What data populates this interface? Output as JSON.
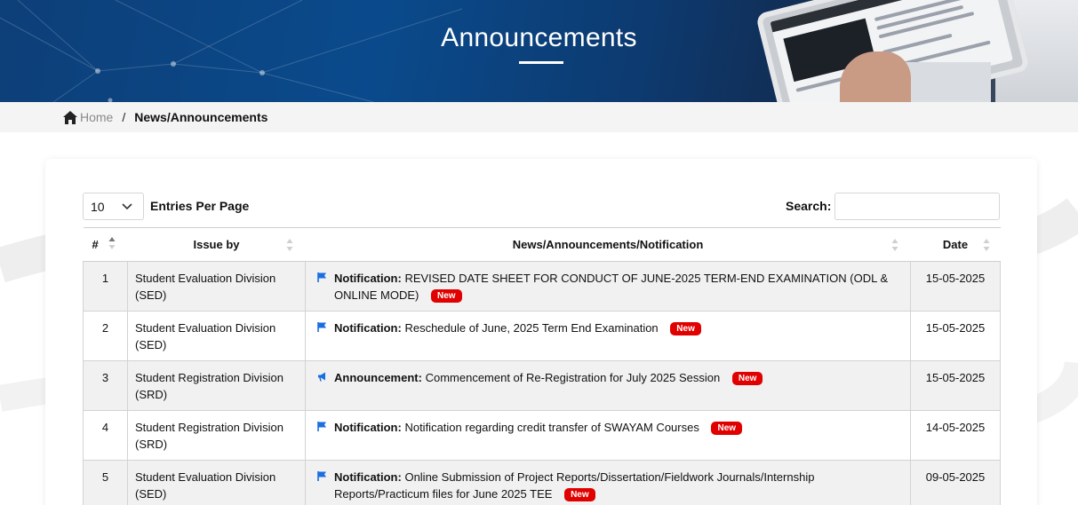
{
  "hero": {
    "title": "Announcements"
  },
  "breadcrumb": {
    "home": "Home",
    "separator": "/",
    "current": "News/Announcements"
  },
  "controls": {
    "entries_value": "10",
    "entries_label": "Entries Per Page",
    "search_label": "Search:",
    "search_value": ""
  },
  "table": {
    "headers": {
      "no": "#",
      "issuer": "Issue by",
      "news": "News/Announcements/Notification",
      "date": "Date"
    },
    "rows": [
      {
        "no": "1",
        "issuer": "Student Evaluation Division (SED)",
        "kind": "Notification:",
        "icon": "flag-icon",
        "text": "REVISED DATE SHEET FOR CONDUCT OF JUNE-2025 TERM-END EXAMINATION (ODL & ONLINE MODE)",
        "badge": "New",
        "date": "15-05-2025"
      },
      {
        "no": "2",
        "issuer": "Student Evaluation Division (SED)",
        "kind": "Notification:",
        "icon": "flag-icon",
        "text": "Reschedule of June, 2025 Term End Examination",
        "badge": "New",
        "date": "15-05-2025"
      },
      {
        "no": "3",
        "issuer": "Student Registration Division (SRD)",
        "kind": "Announcement:",
        "icon": "megaphone-icon",
        "text": "Commencement of Re-Registration for July 2025 Session",
        "badge": "New",
        "date": "15-05-2025"
      },
      {
        "no": "4",
        "issuer": "Student Registration Division (SRD)",
        "kind": "Notification:",
        "icon": "flag-icon",
        "text": "Notification regarding credit transfer of SWAYAM Courses",
        "badge": "New",
        "date": "14-05-2025"
      },
      {
        "no": "5",
        "issuer": "Student Evaluation Division (SED)",
        "kind": "Notification:",
        "icon": "flag-icon",
        "text": "Online Submission of Project Reports/Dissertation/Fieldwork Journals/Internship Reports/Practicum files for June 2025 TEE",
        "badge": "New",
        "date": "09-05-2025"
      }
    ]
  },
  "colors": {
    "badge": "#e00000",
    "icon": "#1a6ee0",
    "banner": "#0a4a8c"
  }
}
